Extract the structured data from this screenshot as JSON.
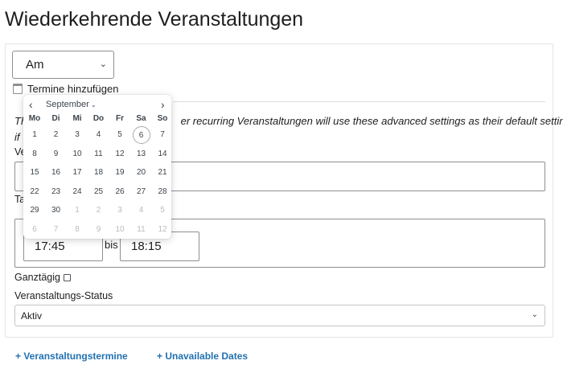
{
  "page": {
    "title": "Wiederkehrende Veranstaltungen"
  },
  "recurrence": {
    "select_value": "Am",
    "add_dates_label": "Termine hinzufügen"
  },
  "info": {
    "text_line1": "Th                                                     er recurring Veranstaltungen will use these advanced settings as their default settings",
    "text_line2": "if"
  },
  "labels": {
    "ve": "Ve",
    "ta": "Ta"
  },
  "time": {
    "start": "17:45",
    "separator": "bis",
    "end": "18:15"
  },
  "allday": {
    "label": "Ganztägig"
  },
  "status": {
    "label": "Veranstaltungs-Status",
    "value": "Aktiv"
  },
  "links": {
    "event_dates": "+ Veranstaltungstermine",
    "unavailable_dates": "+ Unavailable Dates"
  },
  "calendar": {
    "prev": "‹",
    "next": "›",
    "month": "September",
    "weekdays": [
      "Mo",
      "Di",
      "Mi",
      "Do",
      "Fr",
      "Sa",
      "So"
    ],
    "today": "6",
    "weeks": [
      [
        {
          "d": "1",
          "out": false
        },
        {
          "d": "2",
          "out": false
        },
        {
          "d": "3",
          "out": false
        },
        {
          "d": "4",
          "out": false
        },
        {
          "d": "5",
          "out": false
        },
        {
          "d": "6",
          "out": false,
          "today": true
        },
        {
          "d": "7",
          "out": false
        }
      ],
      [
        {
          "d": "8",
          "out": false
        },
        {
          "d": "9",
          "out": false
        },
        {
          "d": "10",
          "out": false
        },
        {
          "d": "11",
          "out": false
        },
        {
          "d": "12",
          "out": false
        },
        {
          "d": "13",
          "out": false
        },
        {
          "d": "14",
          "out": false
        }
      ],
      [
        {
          "d": "15",
          "out": false
        },
        {
          "d": "16",
          "out": false
        },
        {
          "d": "17",
          "out": false
        },
        {
          "d": "18",
          "out": false
        },
        {
          "d": "19",
          "out": false
        },
        {
          "d": "20",
          "out": false
        },
        {
          "d": "21",
          "out": false
        }
      ],
      [
        {
          "d": "22",
          "out": false
        },
        {
          "d": "23",
          "out": false
        },
        {
          "d": "24",
          "out": false
        },
        {
          "d": "25",
          "out": false
        },
        {
          "d": "26",
          "out": false
        },
        {
          "d": "27",
          "out": false
        },
        {
          "d": "28",
          "out": false
        }
      ],
      [
        {
          "d": "29",
          "out": false
        },
        {
          "d": "30",
          "out": false
        },
        {
          "d": "1",
          "out": true
        },
        {
          "d": "2",
          "out": true
        },
        {
          "d": "3",
          "out": true
        },
        {
          "d": "4",
          "out": true
        },
        {
          "d": "5",
          "out": true
        }
      ],
      [
        {
          "d": "6",
          "out": true
        },
        {
          "d": "7",
          "out": true
        },
        {
          "d": "8",
          "out": true
        },
        {
          "d": "9",
          "out": true
        },
        {
          "d": "10",
          "out": true
        },
        {
          "d": "11",
          "out": true
        },
        {
          "d": "12",
          "out": true
        }
      ]
    ]
  },
  "colors": {
    "link": "#2271b1",
    "border": "#8c8f94",
    "text": "#1e1e1e"
  },
  "icons": [
    "calendar-icon",
    "chevron-down-icon",
    "chevron-left-icon",
    "chevron-right-icon"
  ]
}
